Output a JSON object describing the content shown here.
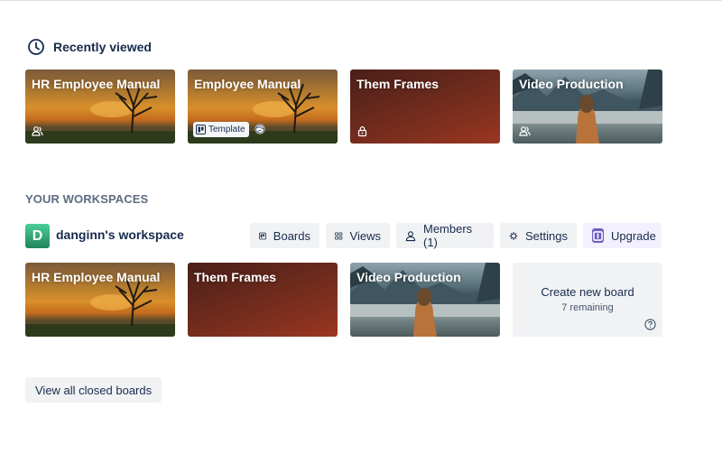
{
  "recent": {
    "title": "Recently viewed",
    "boards": [
      {
        "title": "HR Employee Manual",
        "icon": "workspace-visibility-icon"
      },
      {
        "title": "Employee Manual",
        "badge": "Template",
        "icon": "globe-icon"
      },
      {
        "title": "Them Frames",
        "icon": "lock-icon"
      },
      {
        "title": "Video Production",
        "icon": "workspace-visibility-icon"
      }
    ]
  },
  "workspaces": {
    "heading": "YOUR WORKSPACES",
    "workspace": {
      "initial": "D",
      "name": "danginn's workspace",
      "buttons": {
        "boards": "Boards",
        "views": "Views",
        "members": "Members (1)",
        "settings": "Settings",
        "upgrade": "Upgrade"
      },
      "boards": [
        {
          "title": "HR Employee Manual"
        },
        {
          "title": "Them Frames"
        },
        {
          "title": "Video Production"
        }
      ],
      "create": {
        "title": "Create new board",
        "remaining": "7 remaining"
      }
    }
  },
  "footer": {
    "view_closed": "View all closed boards"
  },
  "colors": {
    "text": "#172b4d",
    "heading": "#5e6c84",
    "button_bg": "#f1f2f4",
    "workspace_green": "#1f845a",
    "upgrade_purple": "#6e5dc6"
  }
}
